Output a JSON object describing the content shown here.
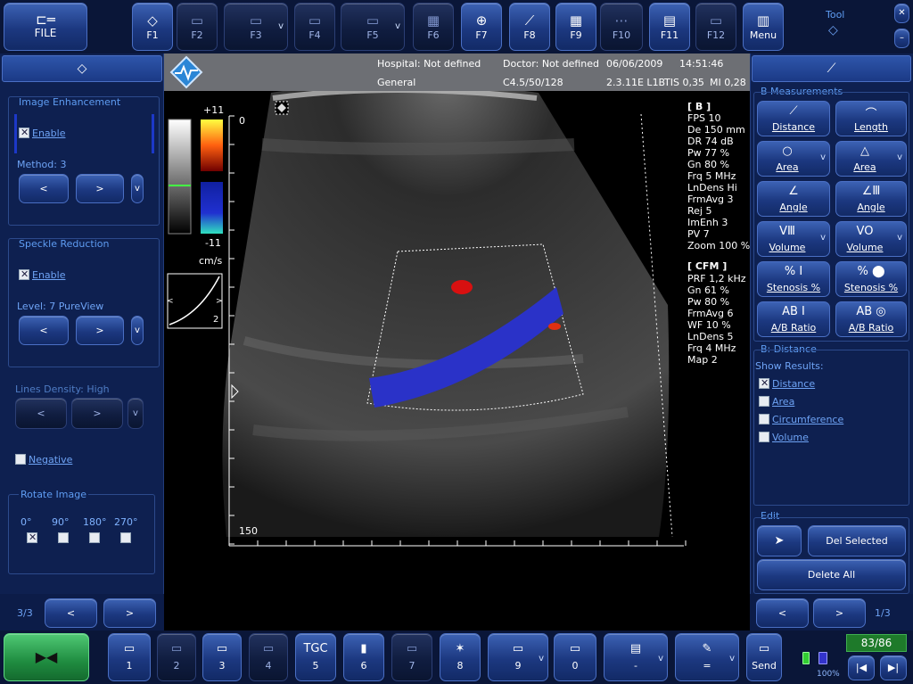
{
  "toolbar": {
    "file": "FILE",
    "keys": [
      {
        "label": "F1",
        "icon": "◇",
        "active": true
      },
      {
        "label": "F2",
        "icon": "▭",
        "active": false
      },
      {
        "label": "F3",
        "icon": "▭",
        "active": false,
        "dropdown": "v"
      },
      {
        "label": "F4",
        "icon": "▭",
        "active": false
      },
      {
        "label": "F5",
        "icon": "▭",
        "active": false,
        "dropdown": "v"
      },
      {
        "label": "F6",
        "icon": "▦",
        "active": false
      },
      {
        "label": "F7",
        "icon": "⊕",
        "active": true
      },
      {
        "label": "F8",
        "icon": "⟋",
        "active": true
      },
      {
        "label": "F9",
        "icon": "▦",
        "active": true
      },
      {
        "label": "F10",
        "icon": "⋯",
        "active": false
      },
      {
        "label": "F11",
        "icon": "▤",
        "active": true
      },
      {
        "label": "F12",
        "icon": "▭",
        "active": false
      },
      {
        "label": "Menu",
        "icon": "▥",
        "active": true
      }
    ],
    "tool_label": "Tool",
    "tool_icon": "◇",
    "close": "✕",
    "minimize": "–"
  },
  "header": {
    "hospital": "Hospital: Not defined",
    "doctor": "Doctor: Not defined",
    "date": "06/06/2009",
    "time": "14:51:46",
    "preset": "General",
    "probe": "C4.5/50/128",
    "version": "2.3.11E L1B",
    "tis": "TIS 0,35",
    "mi": "MI 0,28"
  },
  "left_panel": {
    "icon": "◇",
    "image_enhancement": {
      "title": "Image Enhancement",
      "enable": "Enable",
      "enabled": true,
      "method": "Method: 3",
      "prev": "<",
      "next": ">",
      "more": "v"
    },
    "speckle": {
      "title": "Speckle Reduction",
      "enable": "Enable",
      "enabled": true,
      "level": "Level: 7 PureView",
      "prev": "<",
      "next": ">",
      "more": "v"
    },
    "lines_density": {
      "title": "Lines Density: High",
      "prev": "<",
      "next": ">",
      "more": "v"
    },
    "negative": "Negative",
    "rotate": {
      "title": "Rotate Image",
      "options": [
        "0°",
        "90°",
        "180°",
        "270°"
      ],
      "selected": 0
    },
    "page": "3/3",
    "prev": "<",
    "next": ">"
  },
  "image": {
    "color_max": "+11",
    "color_min": "-11",
    "unit": "cm/s",
    "curve_num": "2",
    "depth_top": "0",
    "depth_bottom": "150",
    "b_title": "[ B ]",
    "b_params": [
      "FPS  10",
      "De  150 mm",
      "DR  74 dB",
      "Pw  77 %",
      "Gn  80 %",
      "Frq  5 MHz",
      "LnDens  Hi",
      "FrmAvg  3",
      "Rej  5",
      "ImEnh  3",
      "PV  7",
      "Zoom  100 %"
    ],
    "cfm_title": "[ CFM ]",
    "cfm_params": [
      "PRF  1,2 kHz",
      "Gn  61 %",
      "Pw  80 %",
      "FrmAvg  6",
      "WF  10 %",
      "LnDens  5",
      "Frq  4 MHz",
      "Map  2"
    ]
  },
  "right_panel": {
    "icon": "⟋",
    "title": "B Measurements",
    "buttons": [
      {
        "label": "Distance",
        "icon": "⟋"
      },
      {
        "label": "Length",
        "icon": "⌒"
      },
      {
        "label": "Area",
        "icon": "○",
        "dropdown": "v"
      },
      {
        "label": "Area",
        "icon": "△",
        "dropdown": "v"
      },
      {
        "label": "Angle",
        "icon": "∠"
      },
      {
        "label": "Angle",
        "icon": "∠Ⅲ"
      },
      {
        "label": "Volume",
        "icon": "VⅢ",
        "dropdown": "v"
      },
      {
        "label": "Volume",
        "icon": "VO",
        "dropdown": "v"
      },
      {
        "label": "Stenosis %",
        "icon": "% Ⅰ"
      },
      {
        "label": "Stenosis %",
        "icon": "% ⬤"
      },
      {
        "label": "A/B Ratio",
        "icon": "AB Ⅰ"
      },
      {
        "label": "A/B Ratio",
        "icon": "AB ◎"
      }
    ],
    "distance_title": "B: Distance",
    "show_results": "Show Results:",
    "results": [
      {
        "label": "Distance",
        "checked": true
      },
      {
        "label": "Area",
        "checked": false
      },
      {
        "label": "Circumference",
        "checked": false
      },
      {
        "label": "Volume",
        "checked": false
      }
    ],
    "edit_title": "Edit",
    "pointer_icon": "➤",
    "del_selected": "Del Selected",
    "delete_all": "Delete All",
    "prev": "<",
    "next": ">",
    "page": "1/3"
  },
  "bottom": {
    "freeze_icon": "▶◀",
    "keys": [
      {
        "label": "1",
        "icon": "▭",
        "active": true
      },
      {
        "label": "2",
        "icon": "▭",
        "active": false
      },
      {
        "label": "3",
        "icon": "▭",
        "active": true
      },
      {
        "label": "4",
        "icon": "▭",
        "active": false
      },
      {
        "label": "5",
        "icon": "TGC",
        "active": true
      },
      {
        "label": "6",
        "icon": "▮",
        "active": true
      },
      {
        "label": "7",
        "icon": "▭",
        "active": false
      },
      {
        "label": "8",
        "icon": "✶",
        "active": true
      },
      {
        "label": "9",
        "icon": "▭",
        "active": true,
        "dropdown": "v"
      },
      {
        "label": "0",
        "icon": "▭",
        "active": true
      },
      {
        "label": "-",
        "icon": "▤",
        "active": true,
        "dropdown": "v"
      },
      {
        "label": "=",
        "icon": "✎",
        "active": true,
        "dropdown": "v"
      },
      {
        "label": "Send",
        "icon": "▭",
        "active": true
      }
    ],
    "cine": "83/86",
    "battery": "100%",
    "prev_frame": "|◀",
    "next_frame": "▶|"
  },
  "colors": {
    "accent": "#2d57b8",
    "background": "#0b1a45",
    "text": "#6ea3f5"
  }
}
